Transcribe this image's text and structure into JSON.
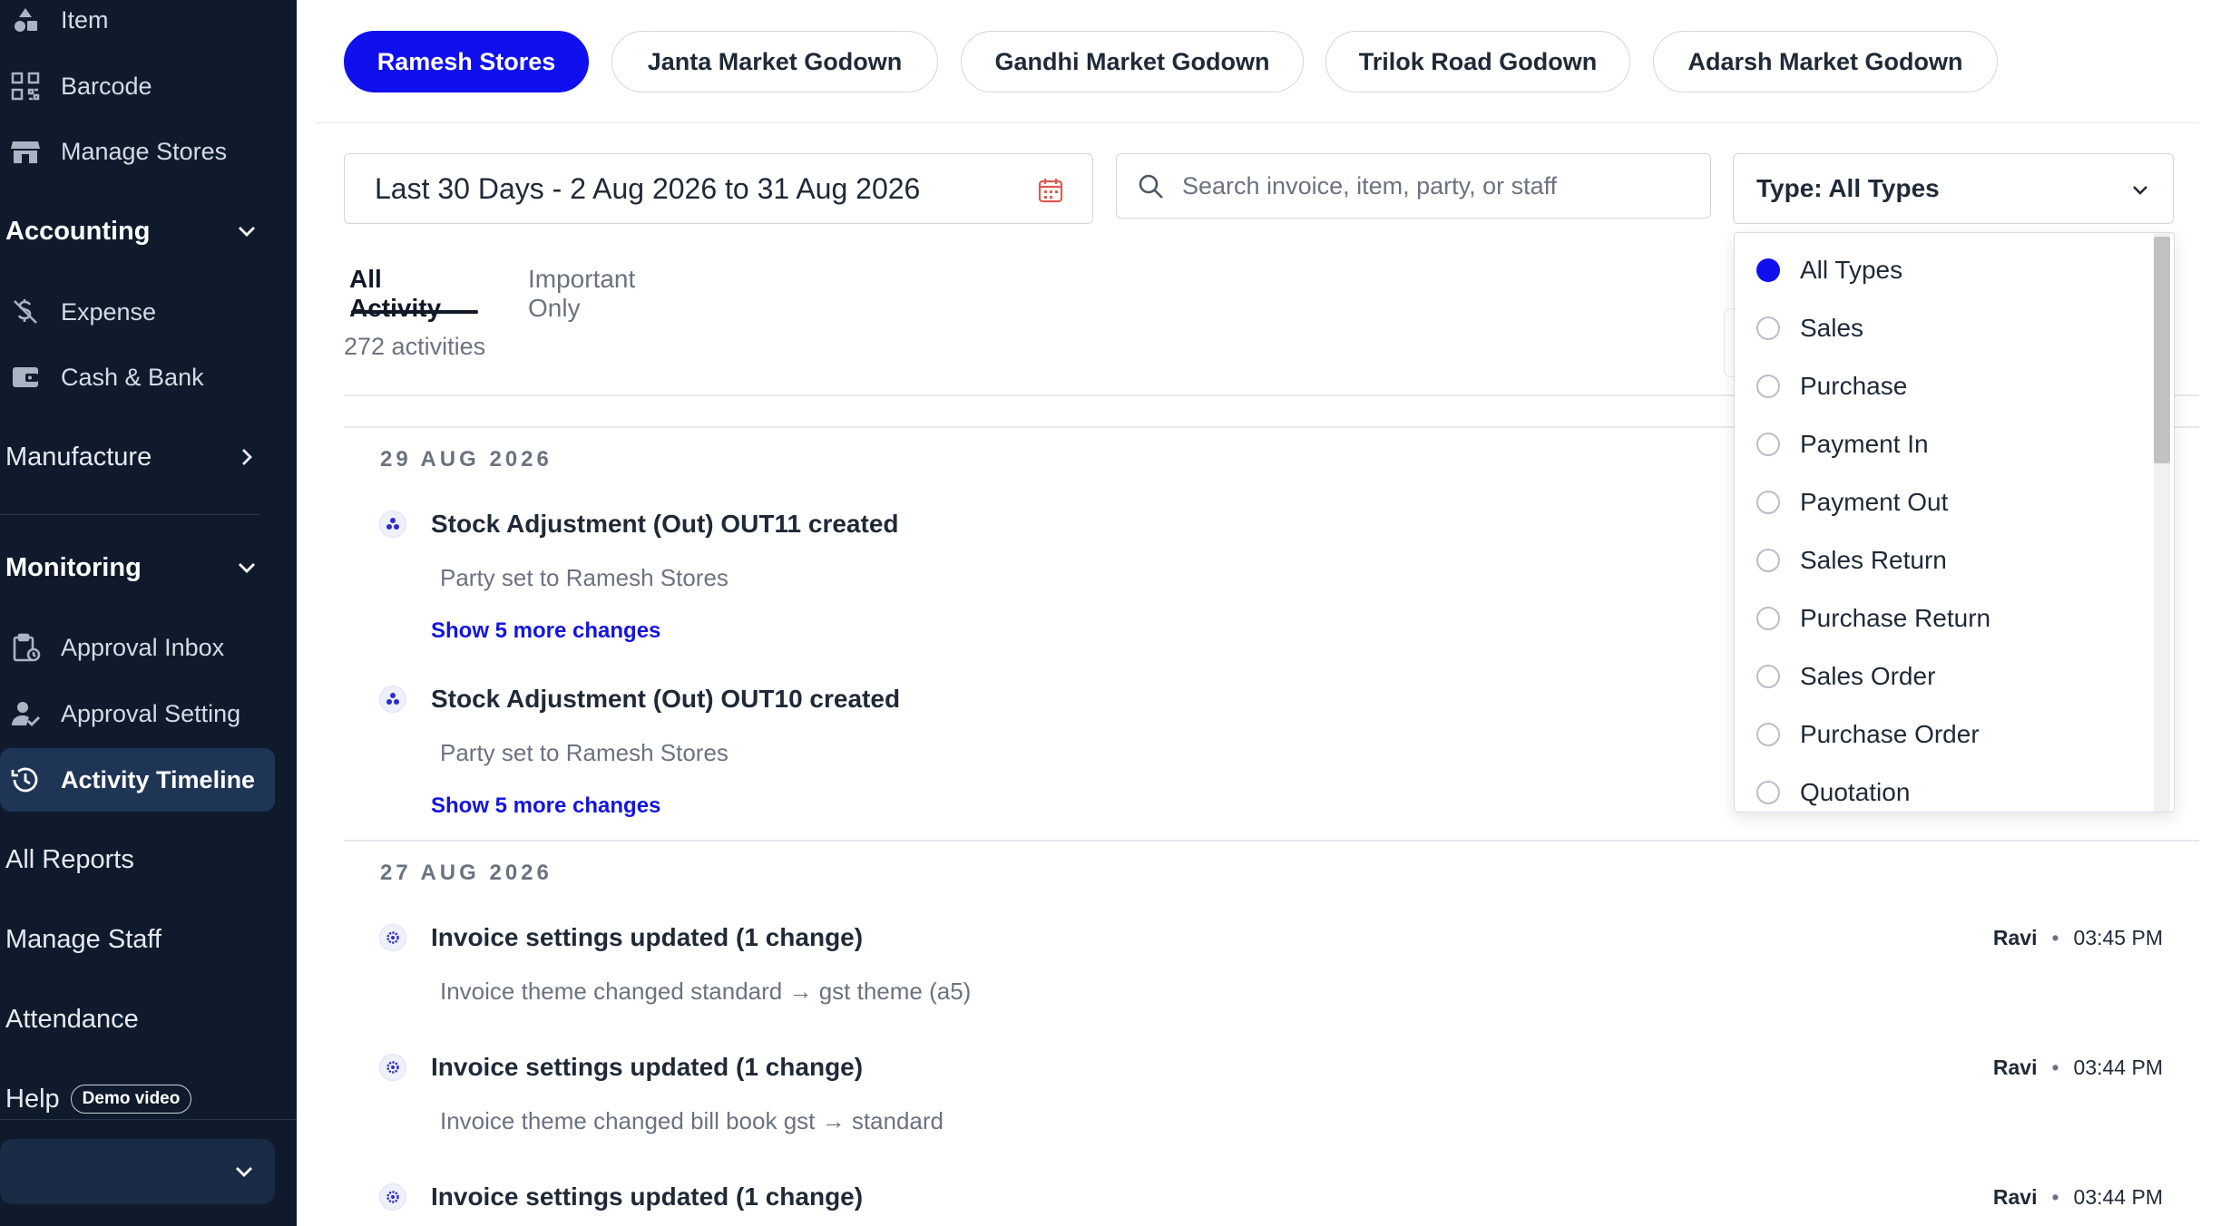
{
  "sidebar": {
    "top_items": [
      {
        "label": "Item",
        "icon": "shapes-icon"
      },
      {
        "label": "Barcode",
        "icon": "barcode-icon"
      },
      {
        "label": "Manage Stores",
        "icon": "store-icon"
      }
    ],
    "accounting": {
      "label": "Accounting",
      "items": [
        {
          "label": "Expense",
          "icon": "expense-icon"
        },
        {
          "label": "Cash & Bank",
          "icon": "wallet-icon"
        }
      ]
    },
    "manufacture": {
      "label": "Manufacture"
    },
    "monitoring": {
      "label": "Monitoring",
      "items": [
        {
          "label": "Approval Inbox",
          "icon": "clipboard-icon"
        },
        {
          "label": "Approval Setting",
          "icon": "user-check-icon"
        },
        {
          "label": "Activity Timeline",
          "icon": "history-icon",
          "active": true
        }
      ]
    },
    "all_reports": "All Reports",
    "manage_staff": "Manage Staff",
    "attendance": "Attendance",
    "help": "Help",
    "demo_video": "Demo video"
  },
  "stores": [
    {
      "label": "Ramesh Stores",
      "active": true
    },
    {
      "label": "Janta Market Godown"
    },
    {
      "label": "Gandhi Market Godown"
    },
    {
      "label": "Trilok Road Godown"
    },
    {
      "label": "Adarsh Market Godown"
    }
  ],
  "filters": {
    "date_range": "Last 30 Days - 2 Aug 2026 to 31 Aug 2026",
    "search_placeholder": "Search invoice, item, party, or staff",
    "search_value": "",
    "type_label": "Type: All Types"
  },
  "tabs": [
    {
      "label": "All Activity",
      "active": true
    },
    {
      "label": "Important Only"
    }
  ],
  "activity_count": "272 activities",
  "groups": [
    {
      "date": "29 AUG 2026",
      "entries": [
        {
          "title": "Stock Adjustment (Out) OUT11 created",
          "detail": "Party set to Ramesh Stores",
          "link": "Show 5 more changes"
        },
        {
          "title": "Stock Adjustment (Out) OUT10 created",
          "detail": "Party set to Ramesh Stores",
          "link": "Show 5 more changes"
        }
      ]
    },
    {
      "date": "27 AUG 2026",
      "entries": [
        {
          "title": "Invoice settings updated (1 change)",
          "detail": "Invoice theme changed standard → gst theme (a5)",
          "user": "Ravi",
          "time": "03:45 PM"
        },
        {
          "title": "Invoice settings updated (1 change)",
          "detail": "Invoice theme changed bill book gst → standard",
          "user": "Ravi",
          "time": "03:44 PM"
        },
        {
          "title": "Invoice settings updated (1 change)",
          "user": "Ravi",
          "time": "03:44 PM"
        }
      ]
    }
  ],
  "type_dropdown": {
    "selected": "All Types",
    "options": [
      "All Types",
      "Sales",
      "Purchase",
      "Payment In",
      "Payment Out",
      "Sales Return",
      "Purchase Return",
      "Sales Order",
      "Purchase Order",
      "Quotation"
    ]
  },
  "colors": {
    "sidebar_bg": "#0f1b2d",
    "accent": "#1010ee",
    "link": "#1414e0"
  }
}
